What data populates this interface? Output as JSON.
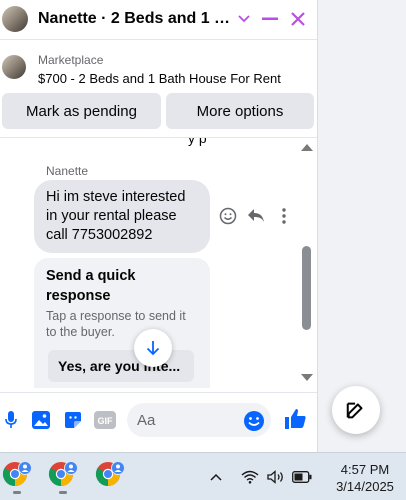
{
  "header": {
    "title": "Nanette · 2 Beds and 1 Bat..."
  },
  "listing": {
    "source": "Marketplace",
    "title": "$700 - 2 Beds and 1 Bath House For Rent"
  },
  "actions": {
    "mark_pending": "Mark as pending",
    "more_options": "More options"
  },
  "messages": {
    "cut_text": "y p",
    "sender": "Nanette",
    "text": "Hi im steve interested in your rental please call 7753002892"
  },
  "quick_response": {
    "title": "Send a quick response",
    "subtitle": "Tap a response to send it to the buyer.",
    "reply": "Yes, are you inte..."
  },
  "composer": {
    "placeholder": "Aa",
    "gif_label": "GIF"
  },
  "taskbar": {
    "time": "4:57 PM",
    "date": "3/14/2025"
  },
  "colors": {
    "accent": "#0866ff",
    "header_icons": "#b94ee0",
    "bubble": "#e4e6eb"
  }
}
